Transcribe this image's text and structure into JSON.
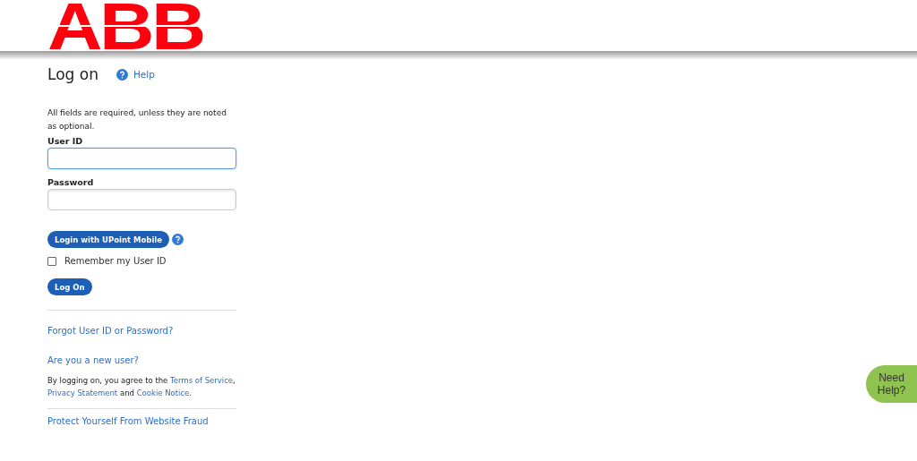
{
  "header": {
    "logo": "ABB"
  },
  "title": "Log on",
  "help_link": "Help",
  "intro": "All fields are required, unless they are noted as optional.",
  "fields": [
    {
      "label": "User ID",
      "focused": true
    },
    {
      "label": "Password",
      "focused": false
    }
  ],
  "mobile_button": "Login with UPoint Mobile",
  "remember": {
    "label": "Remember my User ID",
    "checked": false
  },
  "logon_button": "Log On",
  "links": [
    "Forgot User ID or Password?",
    "Are you a new user?"
  ],
  "agreement": [
    {
      "kind": "text",
      "text": "By logging on, you agree to the "
    },
    {
      "kind": "link",
      "text": "Terms of Service"
    },
    {
      "kind": "text",
      "text": ", "
    },
    {
      "kind": "link",
      "text": "Privacy Statement"
    },
    {
      "kind": "text",
      "text": " and "
    },
    {
      "kind": "link",
      "text": "Cookie Notice"
    },
    {
      "kind": "text",
      "text": "."
    }
  ],
  "fraud_link": "Protect Yourself From Website Fraud",
  "need_help": [
    "Need",
    "Help?"
  ]
}
